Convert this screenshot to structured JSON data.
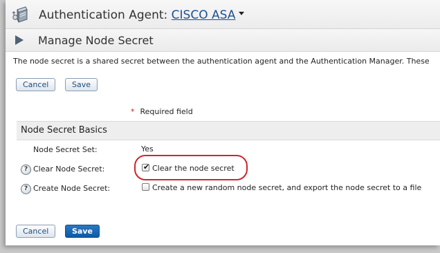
{
  "header": {
    "agent_prefix": "Authentication Agent:",
    "agent_name": "CISCO ASA",
    "server_icon": "server-icon",
    "dropdown_icon": "caret-down-icon"
  },
  "page": {
    "title": "Manage Node Secret",
    "title_icon": "play-arrow-icon",
    "intro": "The node secret is a shared secret between the authentication agent and the Authentication Manager. These"
  },
  "buttons": {
    "cancel": "Cancel",
    "save": "Save"
  },
  "required": {
    "marker": "*",
    "text": "Required field"
  },
  "section": {
    "title": "Node Secret Basics"
  },
  "fields": {
    "node_secret_set": {
      "label": "Node Secret Set:",
      "value": "Yes"
    },
    "clear_node_secret": {
      "label": "Clear Node Secret:",
      "help": "?",
      "option": "Clear the node secret",
      "checked": true
    },
    "create_node_secret": {
      "label": "Create Node Secret:",
      "help": "?",
      "option": "Create a new random node secret, and export the node secret to a file",
      "checked": false
    }
  },
  "colors": {
    "link": "#1d4f91",
    "primary_button": "#0b5aa5",
    "required_star": "#c0221f",
    "annotation": "#cf2430"
  }
}
